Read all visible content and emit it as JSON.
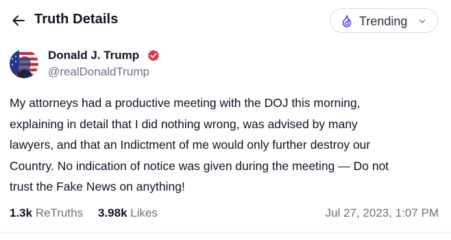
{
  "header": {
    "title": "Truth Details",
    "feed_selector": {
      "label": "Trending",
      "icon": "flame-icon",
      "accent": "#5448ee"
    }
  },
  "post": {
    "author": {
      "name": "Donald J. Trump",
      "handle": "@realDonaldTrump",
      "verified": true,
      "verified_color": "#e0364f"
    },
    "body_lines": [
      "My attorneys had a productive meeting with the DOJ this morning,",
      "explaining in detail that I did nothing wrong, was advised by many",
      "lawyers, and that an Indictment of me would only further destroy our",
      "Country. No indication of notice was given during the meeting — Do not",
      "trust the Fake News on anything!"
    ],
    "stats": {
      "retruths_count": "1.3k",
      "retruths_label": "ReTruths",
      "likes_count": "3.98k",
      "likes_label": "Likes"
    },
    "timestamp": "Jul 27, 2023, 1:07 PM"
  }
}
